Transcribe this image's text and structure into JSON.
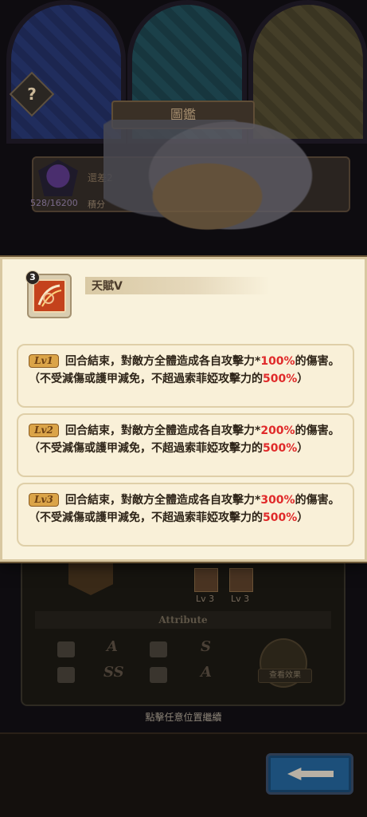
{
  "background": {
    "help_icon_glyph": "?",
    "title": "圖鑑",
    "collection_progress": "528/16200",
    "rank_text": "還差2",
    "progress_label": "積分",
    "skill_levels": [
      "Lv 3",
      "Lv 3"
    ],
    "attribute_title": "Attribute",
    "attribute_grades": [
      "A",
      "S",
      "SS",
      "A"
    ],
    "view_effect_label": "查看效果",
    "tap_hint": "點擊任意位置繼續"
  },
  "talent": {
    "level": "3",
    "name": "天賦V",
    "levels": [
      {
        "tag": "Lv1",
        "text_before": "回合結束，對敵方全體造成各自攻擊力*",
        "percent": "100%",
        "text_middle": "的傷害。（不受減傷或護甲減免，不超過索菲婭攻擊力的",
        "cap": "500%",
        "text_after": "）"
      },
      {
        "tag": "Lv2",
        "text_before": "回合結束，對敵方全體造成各自攻擊力*",
        "percent": "200%",
        "text_middle": "的傷害。（不受減傷或護甲減免，不超過索菲婭攻擊力的",
        "cap": "500%",
        "text_after": "）"
      },
      {
        "tag": "Lv3",
        "text_before": "回合結束，對敵方全體造成各自攻擊力*",
        "percent": "300%",
        "text_middle": "的傷害。（不受減傷或護甲減免，不超過索菲婭攻擊力的",
        "cap": "500%",
        "text_after": "）"
      }
    ]
  },
  "colors": {
    "popup_bg": "#f9f2dc",
    "highlight": "#e02a2a",
    "lv_tag": "#dba448",
    "back_button": "#1c4f7a"
  },
  "icons": {
    "talent": "slash-icon",
    "back": "back-arrow-icon",
    "help": "help-icon"
  }
}
